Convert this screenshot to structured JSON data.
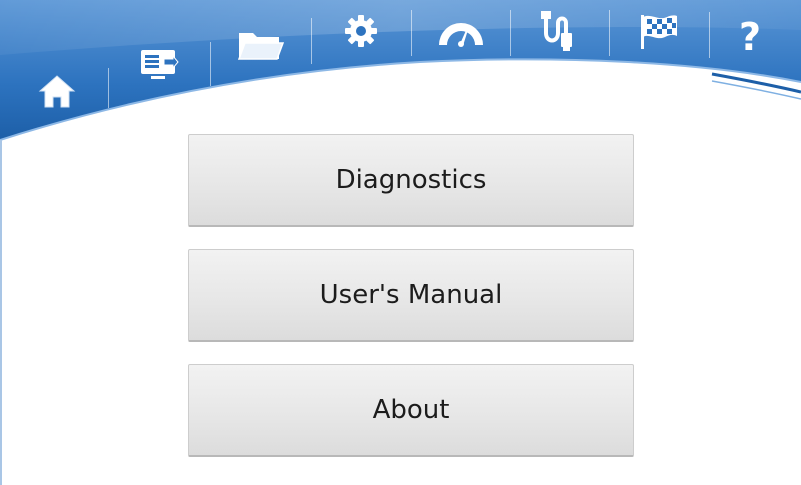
{
  "toolbar": {
    "icons": [
      {
        "id": "home",
        "name": "home-icon"
      },
      {
        "id": "screen",
        "name": "screen-icon"
      },
      {
        "id": "folder",
        "name": "folder-icon"
      },
      {
        "id": "settings",
        "name": "gear-icon"
      },
      {
        "id": "gauge",
        "name": "gauge-icon"
      },
      {
        "id": "usb",
        "name": "usb-cable-icon"
      },
      {
        "id": "flag",
        "name": "checkered-flag-icon"
      },
      {
        "id": "help",
        "name": "help-icon"
      }
    ],
    "help_glyph": "?"
  },
  "menu": {
    "diagnostics_label": "Diagnostics",
    "manual_label": "User's Manual",
    "about_label": "About"
  },
  "colors": {
    "banner_dark": "#1d5fa8",
    "banner_light": "#4f8fd3",
    "icon": "#ffffff",
    "button_text": "#1c1c1c"
  }
}
